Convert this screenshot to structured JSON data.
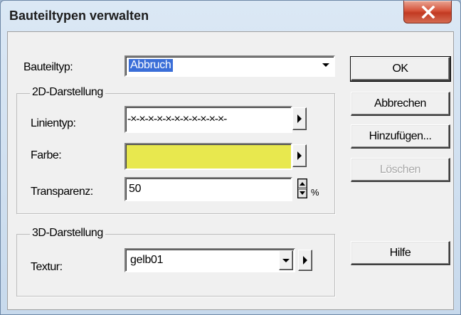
{
  "window": {
    "title": "Bauteiltypen verwalten"
  },
  "form": {
    "bauteiltyp_label": "Bauteiltyp:",
    "bauteiltyp_value": "Abbruch",
    "group_2d": {
      "title": "2D-Darstellung",
      "linientyp_label": "Linientyp:",
      "linientyp_pattern": "-×-×-×-×-×-×-×-×-×-×-×-",
      "farbe_label": "Farbe:",
      "farbe_color": "#e8e84e",
      "transparenz_label": "Transparenz:",
      "transparenz_value": "50",
      "transparenz_unit": "%"
    },
    "group_3d": {
      "title": "3D-Darstellung",
      "textur_label": "Textur:",
      "textur_value": "gelb01"
    }
  },
  "buttons": {
    "ok": "OK",
    "abbrechen": "Abbrechen",
    "hinzufuegen": "Hinzufügen...",
    "loeschen": "Löschen",
    "hilfe": "Hilfe"
  },
  "icons": {
    "close": "close-icon",
    "dropdown": "chevron-down-icon",
    "expand": "triangle-right-icon",
    "spin": "spin-up-down-icon"
  }
}
